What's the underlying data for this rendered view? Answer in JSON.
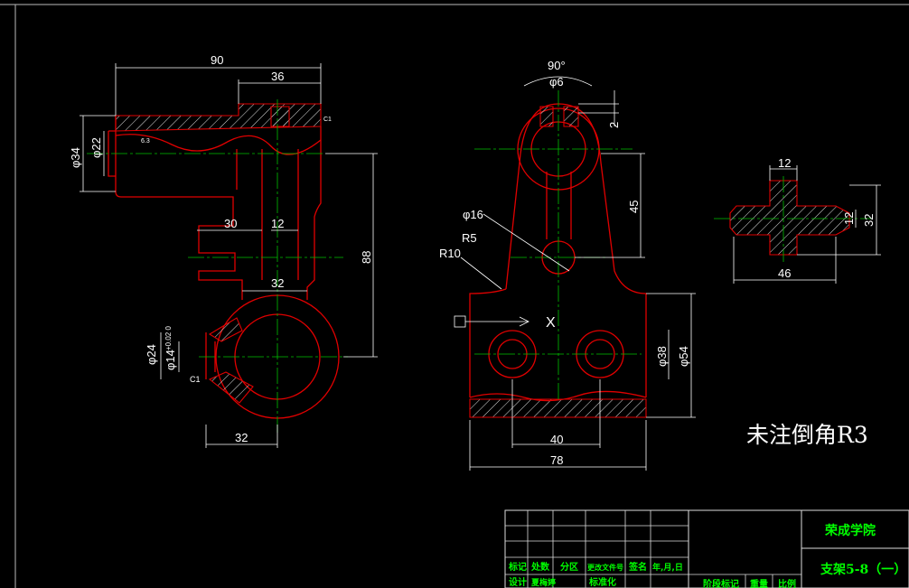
{
  "front_view": {
    "dims": {
      "d90": "90",
      "d36": "36",
      "d34": "φ34",
      "d22": "φ22",
      "d30": "30",
      "d12": "12",
      "d88": "88",
      "d32top": "32",
      "d24": "φ24",
      "d14": "φ14",
      "tol": "+0.02\n0",
      "d32bot": "32",
      "c1a": "C1",
      "c1b": "C1",
      "rough": "6.3"
    }
  },
  "side_view": {
    "dims": {
      "a90": "90°",
      "d6": "φ6",
      "d2": "2",
      "d45": "45",
      "d16": "φ16",
      "r5": "R5",
      "r10": "R10",
      "d38": "φ38",
      "d54": "φ54",
      "d40": "40",
      "d78": "78",
      "x": "X"
    }
  },
  "section_view": {
    "dims": {
      "d12top": "12",
      "d12right": "12",
      "d32": "32",
      "d46": "46"
    }
  },
  "note": "未注倒角R3",
  "title_block": {
    "school": "荣成学院",
    "drawing_name": "支架5-8（一）",
    "row_labels": [
      "标记",
      "处数",
      "分区",
      "更改文件号",
      "签名",
      "年,月,日"
    ],
    "row2_labels": [
      "设计",
      "夏梅婷",
      "",
      "标准化"
    ],
    "bottom_labels": [
      "阶段标记",
      "重量",
      "比例"
    ]
  }
}
